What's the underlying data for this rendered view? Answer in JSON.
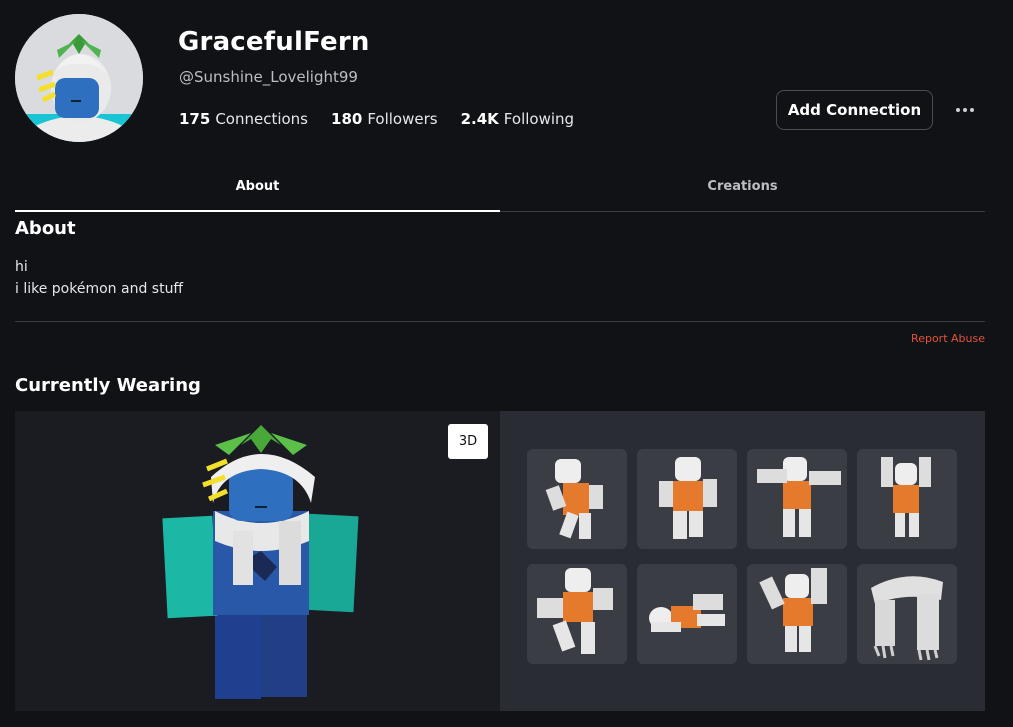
{
  "profile": {
    "display_name": "GracefulFern",
    "username": "@Sunshine_Lovelight99",
    "stats": [
      {
        "value": "175",
        "label": "Connections"
      },
      {
        "value": "180",
        "label": "Followers"
      },
      {
        "value": "2.4K",
        "label": "Following"
      }
    ],
    "add_connection_label": "Add Connection",
    "more_icon": "ellipsis-icon"
  },
  "tabs": [
    {
      "label": "About",
      "active": true
    },
    {
      "label": "Creations",
      "active": false
    }
  ],
  "about": {
    "title": "About",
    "lines": [
      "hi",
      "i like pokémon and stuff"
    ],
    "report_label": "Report Abuse"
  },
  "wearing": {
    "title": "Currently Wearing",
    "view_toggle_label": "3D",
    "items": [
      {
        "name": "emote-1"
      },
      {
        "name": "emote-2"
      },
      {
        "name": "emote-3"
      },
      {
        "name": "emote-4"
      },
      {
        "name": "emote-5"
      },
      {
        "name": "emote-6"
      },
      {
        "name": "emote-7"
      },
      {
        "name": "scarf"
      }
    ]
  },
  "colors": {
    "background": "#111216",
    "report": "#e2533b",
    "teal": "#1bb8a5",
    "blue_pants": "#1f3f8f",
    "orange_shirt": "#e67a2c"
  }
}
